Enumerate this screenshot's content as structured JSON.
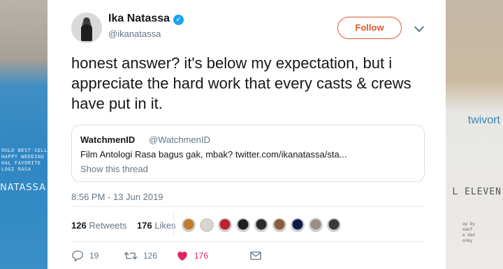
{
  "background": {
    "left_small_text": [
      "OULD BEST-SELLER",
      "HAPPY WEDDING",
      "HAL FAVORITE",
      "LOGI RASA"
    ],
    "left_big_text": "NATASSA",
    "right_text_1": "twivort",
    "right_text_2": "L ELEVEN",
    "right_small_text": [
      "ay by",
      "nanf",
      "e dan",
      "onky"
    ]
  },
  "tweet": {
    "author_name": "Ika Natassa",
    "author_handle": "@ikanatassa",
    "verified": true,
    "follow_label": "Follow",
    "text": "honest answer? it's below my expectation, but i appreciate the hard work that every casts & crews have put in it.",
    "timestamp": "8:56 PM - 13 Jun 2019"
  },
  "quoted_tweet": {
    "name": "WatchmenID",
    "handle": "@WatchmenID",
    "text": "Film Antologi Rasa bagus gak, mbak? twitter.com/ikanatassa/sta...",
    "thread_link": "Show this thread"
  },
  "stats": {
    "retweets_count": "126",
    "retweets_label": "Retweets",
    "likes_count": "176",
    "likes_label": "Likes"
  },
  "likers": [
    {
      "color": "#c27a2c"
    },
    {
      "color": "#d9d5cc"
    },
    {
      "color": "#b8232f"
    },
    {
      "color": "#1f1f1f"
    },
    {
      "color": "#2b2b2b"
    },
    {
      "color": "#8a5a3c"
    },
    {
      "color": "#101a4a"
    },
    {
      "color": "#9a8f86"
    },
    {
      "color": "#3a3a3a"
    }
  ],
  "actions": {
    "reply_count": "19",
    "retweet_count": "126",
    "like_count": "176"
  },
  "colors": {
    "follow_accent": "#e0592a",
    "like_red": "#e0245e",
    "verified_blue": "#1da1f2",
    "secondary_text": "#657786"
  },
  "icons": {
    "verified": "verified-badge-icon",
    "menu": "chevron-down-icon",
    "reply": "reply-icon",
    "retweet": "retweet-icon",
    "like": "heart-icon",
    "message": "envelope-icon"
  }
}
